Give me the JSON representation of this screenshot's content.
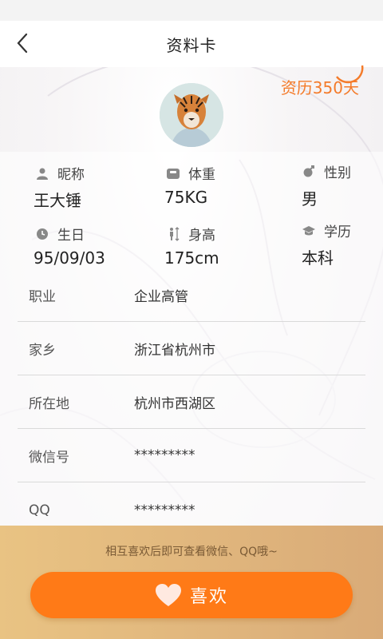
{
  "header": {
    "title": "资料卡",
    "back_icon": "chevron-left-icon"
  },
  "seniority": "资历350天",
  "profile": {
    "stats": [
      {
        "icon": "person-icon",
        "label": "昵称",
        "value": "王大锤"
      },
      {
        "icon": "scale-icon",
        "label": "体重",
        "value": "75KG"
      },
      {
        "icon": "gender-icon",
        "label": "性别",
        "value": "男"
      },
      {
        "icon": "clock-icon",
        "label": "生日",
        "value": "95/09/03"
      },
      {
        "icon": "height-icon",
        "label": "身高",
        "value": "175cm"
      },
      {
        "icon": "graduation-cap-icon",
        "label": "学历",
        "value": "本科"
      }
    ],
    "rows": [
      {
        "key": "职业",
        "value": "企业高管"
      },
      {
        "key": "家乡",
        "value": "浙江省杭州市"
      },
      {
        "key": "所在地",
        "value": "杭州市西湖区"
      },
      {
        "key": "微信号",
        "value": "*********"
      },
      {
        "key": "QQ",
        "value": "*********"
      }
    ]
  },
  "footer": {
    "hint": "相互喜欢后即可查看微信、QQ哦~",
    "like_label": "喜欢",
    "like_icon": "heart-icon"
  },
  "colors": {
    "accent": "#ff7a17",
    "seniority": "#f47b2a",
    "footer_from": "#e9c383",
    "footer_to": "#d9ab78"
  }
}
